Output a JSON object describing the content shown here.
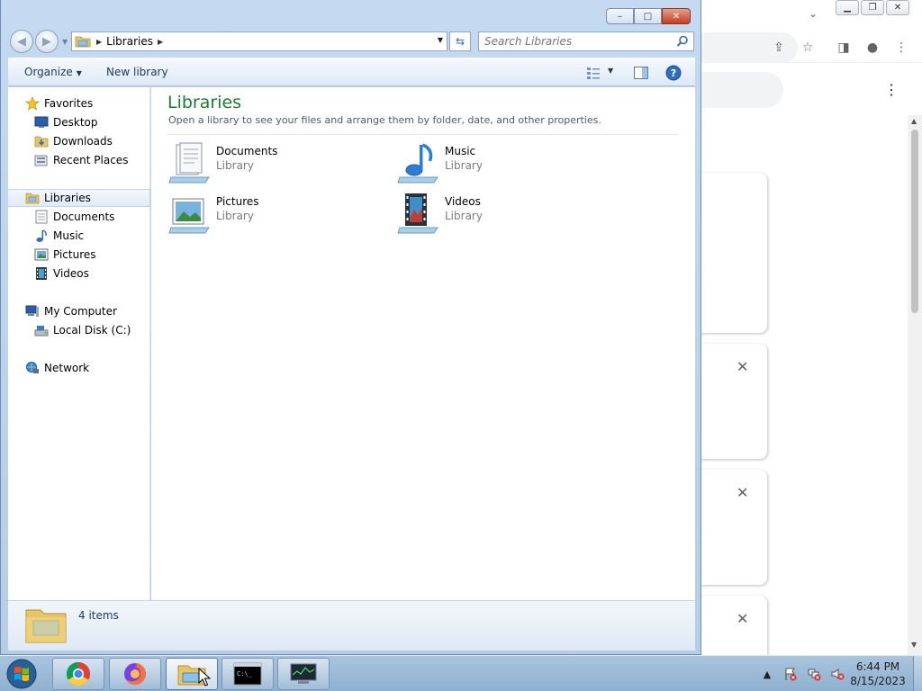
{
  "explorer": {
    "window_buttons": {
      "minimize": "–",
      "maximize": "□",
      "close": "✕"
    },
    "address": {
      "crumb": "Libraries"
    },
    "search": {
      "placeholder": "Search Libraries"
    },
    "toolbar": {
      "organize": "Organize",
      "new_library": "New library"
    },
    "nav": {
      "favorites": "Favorites",
      "desktop": "Desktop",
      "downloads": "Downloads",
      "recent_places": "Recent Places",
      "libraries": "Libraries",
      "documents": "Documents",
      "music": "Music",
      "pictures": "Pictures",
      "videos": "Videos",
      "my_computer": "My Computer",
      "local_disk": "Local Disk (C:)",
      "network": "Network"
    },
    "content": {
      "title": "Libraries",
      "subtitle": "Open a library to see your files and arrange them by folder, date, and other properties.",
      "libraries": [
        {
          "name": "Documents",
          "type": "Library",
          "icon": "documents-library-icon"
        },
        {
          "name": "Music",
          "type": "Library",
          "icon": "music-library-icon"
        },
        {
          "name": "Pictures",
          "type": "Library",
          "icon": "pictures-library-icon"
        },
        {
          "name": "Videos",
          "type": "Library",
          "icon": "videos-library-icon"
        }
      ]
    },
    "details": {
      "count_text": "4 items"
    }
  },
  "taskbar": {
    "apps": [
      "chrome",
      "firefox",
      "windows-explorer",
      "command-prompt",
      "system-monitor"
    ],
    "active_app": "windows-explorer",
    "clock": {
      "time": "6:44 PM",
      "date": "8/15/2023"
    }
  },
  "colors": {
    "title_green": "#1e7a36",
    "selection": "#e0eaf6",
    "taskbar": "#9fbad5"
  }
}
